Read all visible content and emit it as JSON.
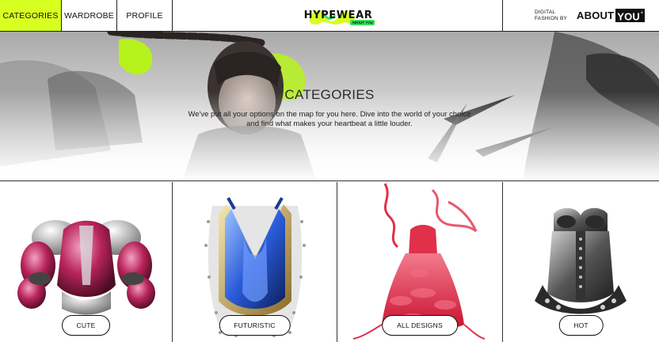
{
  "nav": {
    "tabs": [
      {
        "label": "CATEGORIES",
        "active": true
      },
      {
        "label": "WARDROBE",
        "active": false
      },
      {
        "label": "PROFILE",
        "active": false
      }
    ],
    "logo": {
      "text": "HYPEWEAR",
      "sub": "ABOUT YOU"
    },
    "digital_line1": "DIGITAL",
    "digital_line2": "FASHION BY",
    "brand_about": "ABOUT",
    "brand_you": "YOU",
    "brand_mark": "°"
  },
  "hero": {
    "title": "CATEGORIES",
    "desc_line1": "We've put all your options on the map for you here. Dive into the world of your choice",
    "desc_line2": "and find what makes your heartbeat a little louder."
  },
  "categories": [
    {
      "label": "CUTE"
    },
    {
      "label": "FUTURISTIC"
    },
    {
      "label": "ALL DESIGNS"
    },
    {
      "label": "HOT"
    }
  ],
  "colors": {
    "accent": "#d7ff1f",
    "logo_green": "#39e05a",
    "cute_pink": "#b8245a",
    "futuristic_blue": "#2a5bd8",
    "all_designs_red": "#e0304a",
    "hot_gray": "#555555"
  }
}
